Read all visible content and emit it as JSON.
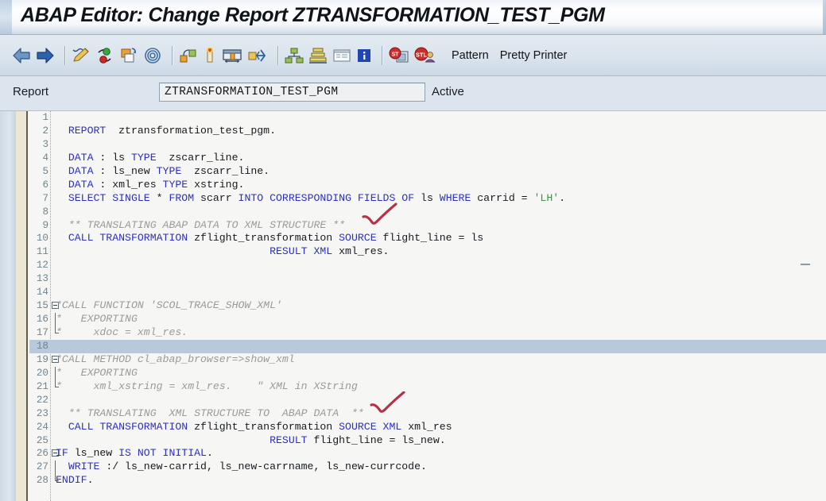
{
  "window": {
    "title": "ABAP Editor: Change Report ZTRANSFORMATION_TEST_PGM"
  },
  "toolbar": {
    "icons": [
      {
        "name": "back-arrow-icon",
        "label": "Back"
      },
      {
        "name": "forward-arrow-icon",
        "label": "Forward"
      },
      {
        "name": "check-syntax-pencil-icon",
        "label": "Check"
      },
      {
        "name": "activate-icon",
        "label": "Activate"
      },
      {
        "name": "copy-object-icon",
        "label": "Copy"
      },
      {
        "name": "where-used-list-icon",
        "label": "Where-Used List"
      },
      {
        "name": "display-object-list-icon",
        "label": "Object List"
      },
      {
        "name": "breakpoint-icon",
        "label": "Breakpoint"
      },
      {
        "name": "debugging-icon",
        "label": "Debugging"
      },
      {
        "name": "navigate-icon",
        "label": "Navigate"
      },
      {
        "name": "object-hierarchy-icon",
        "label": "Hierarchy"
      },
      {
        "name": "stack-layers-icon",
        "label": "Layers"
      },
      {
        "name": "list-view-icon",
        "label": "List View"
      },
      {
        "name": "information-icon",
        "label": "Information"
      },
      {
        "name": "abap-dictionary-icon",
        "label": "Dictionary"
      },
      {
        "name": "abap-user-icon",
        "label": "User"
      }
    ],
    "pattern_label": "Pattern",
    "pretty_printer_label": "Pretty Printer"
  },
  "report_bar": {
    "label": "Report",
    "value": "ZTRANSFORMATION_TEST_PGM",
    "placeholder": "",
    "status": "Active"
  },
  "editor": {
    "selected_line": 18,
    "colors": {
      "keyword": "#2f2fbf",
      "comment": "#9a9a96",
      "string": "#2f9b3e",
      "text": "#161a1e",
      "line_number": "#70848f",
      "selection": "#b7c9da",
      "annotation": "#b6304a"
    },
    "lines": [
      {
        "n": 1,
        "fold": "",
        "tokens": []
      },
      {
        "n": 2,
        "fold": "",
        "tokens": [
          {
            "t": "  ",
            "c": ""
          },
          {
            "t": "REPORT",
            "c": "kw"
          },
          {
            "t": "  ztransformation_test_pgm.",
            "c": ""
          }
        ]
      },
      {
        "n": 3,
        "fold": "",
        "tokens": []
      },
      {
        "n": 4,
        "fold": "",
        "tokens": [
          {
            "t": "  ",
            "c": ""
          },
          {
            "t": "DATA",
            "c": "kw"
          },
          {
            "t": " : ls ",
            "c": ""
          },
          {
            "t": "TYPE",
            "c": "kw"
          },
          {
            "t": "  zscarr_line.",
            "c": ""
          }
        ]
      },
      {
        "n": 5,
        "fold": "",
        "tokens": [
          {
            "t": "  ",
            "c": ""
          },
          {
            "t": "DATA",
            "c": "kw"
          },
          {
            "t": " : ls_new ",
            "c": ""
          },
          {
            "t": "TYPE",
            "c": "kw"
          },
          {
            "t": "  zscarr_line.",
            "c": ""
          }
        ]
      },
      {
        "n": 6,
        "fold": "",
        "tokens": [
          {
            "t": "  ",
            "c": ""
          },
          {
            "t": "DATA",
            "c": "kw"
          },
          {
            "t": " : xml_res ",
            "c": ""
          },
          {
            "t": "TYPE",
            "c": "kw"
          },
          {
            "t": " xstring.",
            "c": ""
          }
        ]
      },
      {
        "n": 7,
        "fold": "",
        "tokens": [
          {
            "t": "  ",
            "c": ""
          },
          {
            "t": "SELECT SINGLE",
            "c": "kw"
          },
          {
            "t": " * ",
            "c": ""
          },
          {
            "t": "FROM",
            "c": "kw"
          },
          {
            "t": " scarr ",
            "c": ""
          },
          {
            "t": "INTO CORRESPONDING FIELDS OF",
            "c": "kw"
          },
          {
            "t": " ls ",
            "c": ""
          },
          {
            "t": "WHERE",
            "c": "kw"
          },
          {
            "t": " carrid = ",
            "c": ""
          },
          {
            "t": "'LH'",
            "c": "str"
          },
          {
            "t": ".",
            "c": ""
          }
        ]
      },
      {
        "n": 8,
        "fold": "",
        "tokens": []
      },
      {
        "n": 9,
        "fold": "",
        "tokens": [
          {
            "t": "  ** TRANSLATING ABAP DATA TO XML STRUCTURE **",
            "c": "cmt"
          }
        ]
      },
      {
        "n": 10,
        "fold": "",
        "tokens": [
          {
            "t": "  ",
            "c": ""
          },
          {
            "t": "CALL TRANSFORMATION",
            "c": "kw"
          },
          {
            "t": " zflight_transformation ",
            "c": ""
          },
          {
            "t": "SOURCE",
            "c": "kw"
          },
          {
            "t": " flight_line = ls",
            "c": ""
          }
        ]
      },
      {
        "n": 11,
        "fold": "",
        "tokens": [
          {
            "t": "                                  ",
            "c": ""
          },
          {
            "t": "RESULT XML",
            "c": "kw"
          },
          {
            "t": " xml_res.",
            "c": ""
          }
        ]
      },
      {
        "n": 12,
        "fold": "",
        "tokens": []
      },
      {
        "n": 13,
        "fold": "",
        "tokens": []
      },
      {
        "n": 14,
        "fold": "",
        "tokens": []
      },
      {
        "n": 15,
        "fold": "start",
        "tokens": [
          {
            "t": "*CALL FUNCTION 'SCOL_TRACE_SHOW_XML'",
            "c": "cmt"
          }
        ]
      },
      {
        "n": 16,
        "fold": "mid",
        "tokens": [
          {
            "t": "*   EXPORTING",
            "c": "cmt"
          }
        ]
      },
      {
        "n": 17,
        "fold": "end",
        "tokens": [
          {
            "t": "*     xdoc = xml_res.",
            "c": "cmt"
          }
        ]
      },
      {
        "n": 18,
        "fold": "",
        "tokens": []
      },
      {
        "n": 19,
        "fold": "start",
        "tokens": [
          {
            "t": "*CALL METHOD cl_abap_browser=>show_xml",
            "c": "cmt"
          }
        ]
      },
      {
        "n": 20,
        "fold": "mid",
        "tokens": [
          {
            "t": "*   EXPORTING",
            "c": "cmt"
          }
        ]
      },
      {
        "n": 21,
        "fold": "end",
        "tokens": [
          {
            "t": "*     xml_xstring = xml_res.    \" XML in XString",
            "c": "cmt"
          }
        ]
      },
      {
        "n": 22,
        "fold": "",
        "tokens": []
      },
      {
        "n": 23,
        "fold": "",
        "tokens": [
          {
            "t": "  ** TRANSLATING  XML STRUCTURE TO  ABAP DATA  **",
            "c": "cmt"
          }
        ]
      },
      {
        "n": 24,
        "fold": "",
        "tokens": [
          {
            "t": "  ",
            "c": ""
          },
          {
            "t": "CALL TRANSFORMATION",
            "c": "kw"
          },
          {
            "t": " zflight_transformation ",
            "c": ""
          },
          {
            "t": "SOURCE XML",
            "c": "kw"
          },
          {
            "t": " xml_res",
            "c": ""
          }
        ]
      },
      {
        "n": 25,
        "fold": "",
        "tokens": [
          {
            "t": "                                  ",
            "c": ""
          },
          {
            "t": "RESULT",
            "c": "kw"
          },
          {
            "t": " flight_line = ls_new.",
            "c": ""
          }
        ]
      },
      {
        "n": 26,
        "fold": "start",
        "tokens": [
          {
            "t": "IF",
            "c": "kw"
          },
          {
            "t": " ls_new ",
            "c": ""
          },
          {
            "t": "IS NOT INITIAL",
            "c": "kw"
          },
          {
            "t": ".",
            "c": ""
          }
        ]
      },
      {
        "n": 27,
        "fold": "mid",
        "tokens": [
          {
            "t": "  ",
            "c": ""
          },
          {
            "t": "WRITE",
            "c": "kw"
          },
          {
            "t": " :/ ls_new-carrid, ls_new-carrname, ls_new-currcode.",
            "c": ""
          }
        ]
      },
      {
        "n": 28,
        "fold": "end",
        "tokens": [
          {
            "t": "",
            "c": ""
          },
          {
            "t": "ENDIF",
            "c": "kw"
          },
          {
            "t": ".",
            "c": ""
          }
        ]
      }
    ],
    "annotations": [
      {
        "name": "red-check-mark-1",
        "after_line": 9,
        "note": "hand-drawn red check"
      },
      {
        "name": "red-check-mark-2",
        "after_line": 23,
        "note": "hand-drawn red check"
      }
    ]
  }
}
